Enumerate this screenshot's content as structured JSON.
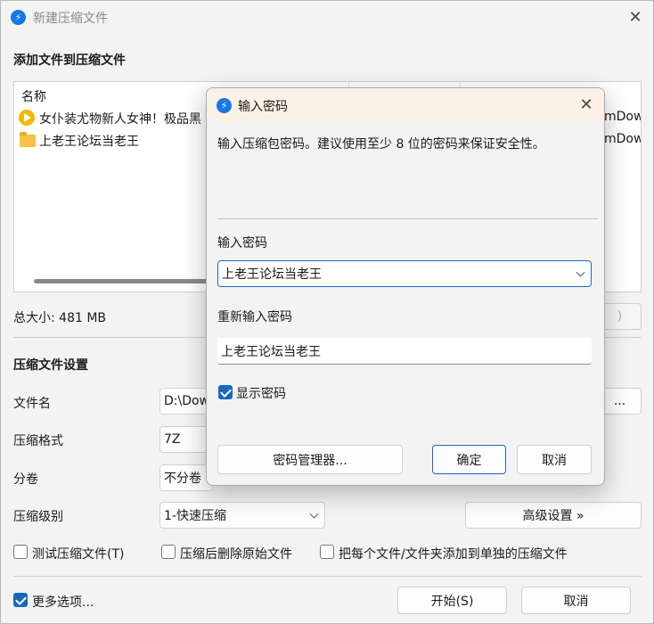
{
  "window": {
    "title": "新建压缩文件",
    "add_files_heading": "添加文件到压缩文件",
    "file_list": {
      "columns": [
        "名称",
        "",
        ""
      ],
      "rows": [
        {
          "icon": "video-file-icon",
          "name": "女仆装尤物新人女神！极品黑",
          "path": "mDow"
        },
        {
          "icon": "folder-icon",
          "name": "上老王论坛当老王",
          "path": "mDow"
        }
      ]
    },
    "total_size": "总大小: 481 MB",
    "settings_heading": "压缩文件设置",
    "filename_label": "文件名",
    "filename_value": "D:\\Dow",
    "browse_label": "...",
    "format_label": "压缩格式",
    "format_value": "7Z",
    "split_label": "分卷",
    "split_value": "不分卷",
    "level_label": "压缩级别",
    "level_value": "1-快速压缩",
    "advanced_button": "高级设置 »",
    "remove_button": ")",
    "test_checkbox": "测试压缩文件(T)",
    "delete_checkbox": "压缩后删除原始文件",
    "separate_checkbox": "把每个文件/文件夹添加到单独的压缩文件",
    "more_options_checkbox": "更多选项...",
    "start_button": "开始(S)",
    "cancel_button": "取消",
    "close_glyph": "✕"
  },
  "dialog": {
    "title": "输入密码",
    "description": "输入压缩包密码。建议使用至少 8 位的密码来保证安全性。",
    "password_label": "输入密码",
    "password_value": "上老王论坛当老王",
    "confirm_label": "重新输入密码",
    "confirm_value": "上老王论坛当老王",
    "show_password_label": "显示密码",
    "show_password_checked": true,
    "manager_button": "密码管理器...",
    "ok_button": "确定",
    "cancel_button": "取消",
    "close_glyph": "✕"
  },
  "colors": {
    "accent": "#1867c0",
    "app_icon": "#1677e6",
    "dialog_title_bg": "#fbf1e6"
  }
}
